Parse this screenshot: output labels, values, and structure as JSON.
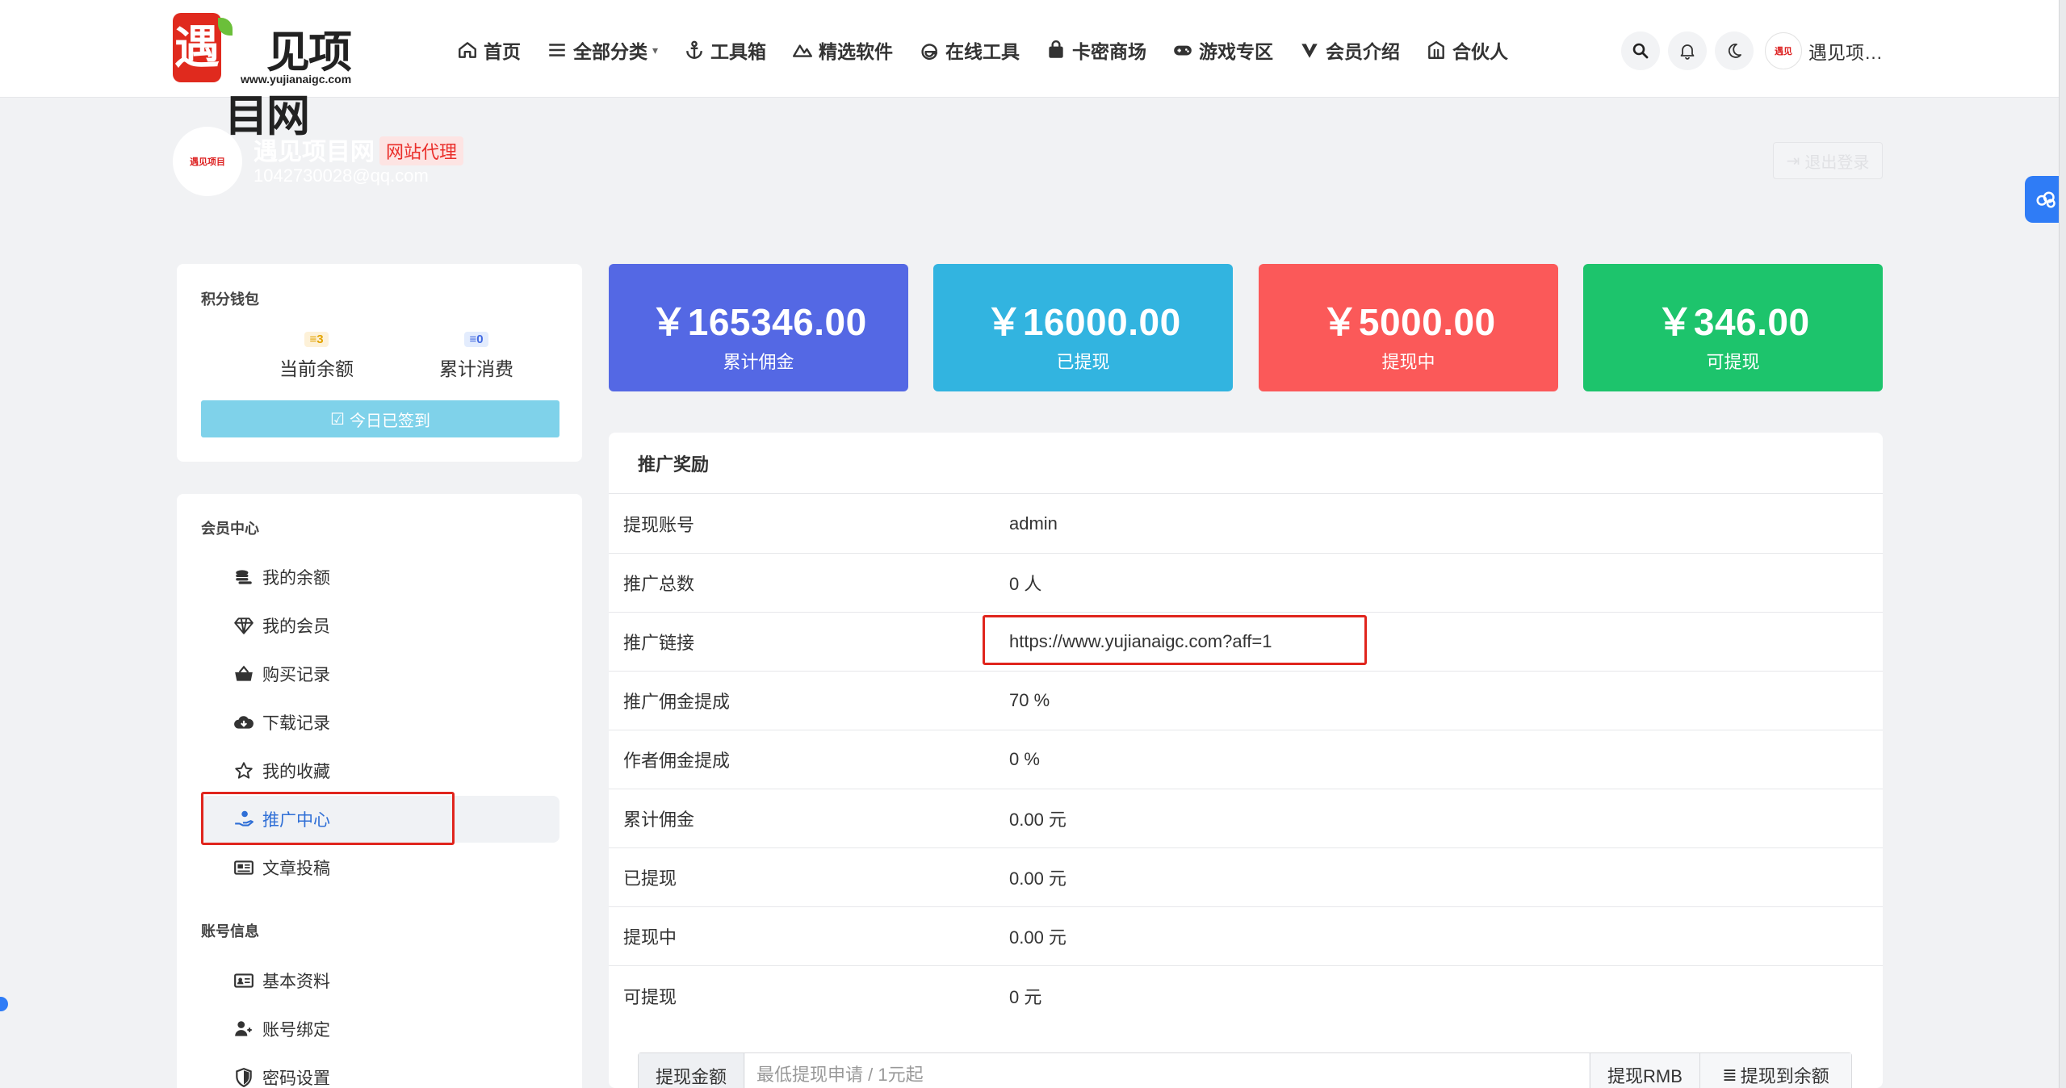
{
  "header": {
    "logo_text": "遇见项目网",
    "logo_badge": "遇",
    "logo_sub": "www.yujianaigc.com",
    "nav": [
      {
        "label": "首页",
        "icon": "home-icon"
      },
      {
        "label": "全部分类",
        "icon": "list-icon"
      },
      {
        "label": "工具箱",
        "icon": "anchor-icon"
      },
      {
        "label": "精选软件",
        "icon": "mountain-icon"
      },
      {
        "label": "在线工具",
        "icon": "edge-icon"
      },
      {
        "label": "卡密商场",
        "icon": "bag-icon"
      },
      {
        "label": "游戏专区",
        "icon": "gamepad-icon"
      },
      {
        "label": "会员介绍",
        "icon": "v-icon"
      },
      {
        "label": "合伙人",
        "icon": "building-icon"
      }
    ],
    "user_name": "遇见项…"
  },
  "profile": {
    "name": "遇见项目网",
    "tag": "网站代理",
    "email": "1042730028@qq.com",
    "logout_label": "退出登录"
  },
  "wallet": {
    "title": "积分钱包",
    "balance_badge": "3",
    "balance_label": "当前余额",
    "spent_badge": "0",
    "spent_label": "累计消费",
    "signin_label": "今日已签到"
  },
  "member": {
    "title": "会员中心",
    "items": [
      {
        "label": "我的余额",
        "icon": "coins-icon"
      },
      {
        "label": "我的会员",
        "icon": "diamond-icon"
      },
      {
        "label": "购买记录",
        "icon": "basket-icon"
      },
      {
        "label": "下载记录",
        "icon": "cloud-download-icon"
      },
      {
        "label": "我的收藏",
        "icon": "star-icon"
      },
      {
        "label": "推广中心",
        "icon": "hand-coin-icon"
      },
      {
        "label": "文章投稿",
        "icon": "newspaper-icon"
      }
    ],
    "account_title": "账号信息",
    "account_items": [
      {
        "label": "基本资料",
        "icon": "id-card-icon"
      },
      {
        "label": "账号绑定",
        "icon": "user-link-icon"
      },
      {
        "label": "密码设置",
        "icon": "shield-icon"
      }
    ]
  },
  "stats": [
    {
      "amount": "￥165346.00",
      "label": "累计佣金",
      "color": "#5468e4"
    },
    {
      "amount": "￥16000.00",
      "label": "已提现",
      "color": "#32b4e0"
    },
    {
      "amount": "￥5000.00",
      "label": "提现中",
      "color": "#fb5959"
    },
    {
      "amount": "￥346.00",
      "label": "可提现",
      "color": "#1dc46c"
    }
  ],
  "promo": {
    "title": "推广奖励",
    "rows": [
      {
        "k": "提现账号",
        "v": "admin"
      },
      {
        "k": "推广总数",
        "v": "0 人"
      },
      {
        "k": "推广链接",
        "v": "https://www.yujianaigc.com?aff=1"
      },
      {
        "k": "推广佣金提成",
        "v": "70 %"
      },
      {
        "k": "作者佣金提成",
        "v": "0 %"
      },
      {
        "k": "累计佣金",
        "v": "0.00 元"
      },
      {
        "k": "已提现",
        "v": "0.00 元"
      },
      {
        "k": "提现中",
        "v": "0.00 元"
      },
      {
        "k": "可提现",
        "v": "0 元"
      }
    ],
    "withdraw_label": "提现金额",
    "withdraw_placeholder": "最低提现申请 / 1元起",
    "withdraw_rmb": "提现RMB",
    "withdraw_balance": "提现到余额"
  },
  "colors": {
    "accent": "#2f7cf6",
    "highlight": "#e0251d",
    "brand_red": "#e02a1e"
  }
}
